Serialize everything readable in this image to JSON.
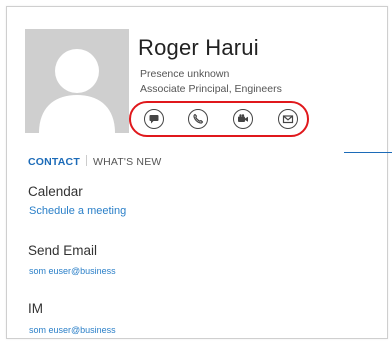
{
  "contact": {
    "name": "Roger Harui",
    "presence": "Presence unknown",
    "role": "Associate Principal,  Engineers"
  },
  "actions": [
    {
      "icon": "chat-icon"
    },
    {
      "icon": "phone-icon"
    },
    {
      "icon": "video-icon"
    },
    {
      "icon": "email-icon"
    }
  ],
  "tabs": {
    "contact": "CONTACT",
    "whats_new": "WHAT'S NEW"
  },
  "details": {
    "calendar_label": "Calendar",
    "calendar_link": "Schedule a meeting",
    "email_label": "Send Email",
    "email_value": "som euser@business",
    "im_label": "IM",
    "im_value": "som euser@business"
  },
  "colors": {
    "accent": "#1c6bb8",
    "highlight_ring": "#e0181c",
    "avatar_bg": "#cfcfcf"
  }
}
